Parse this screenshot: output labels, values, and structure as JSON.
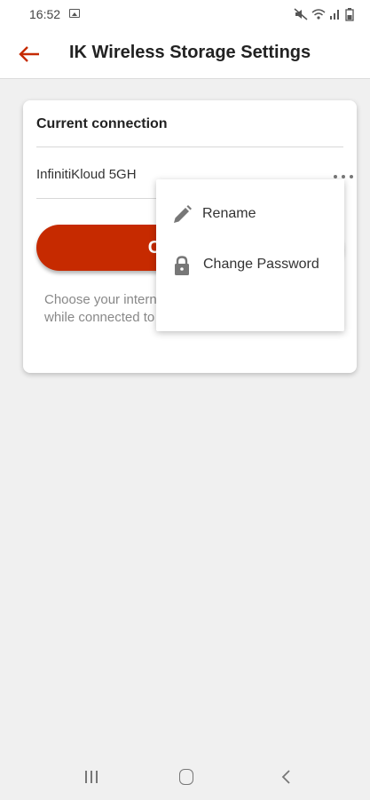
{
  "status_bar": {
    "time": "16:52",
    "icons": [
      "gallery-icon",
      "mute-icon",
      "wifi-icon",
      "signal-icon",
      "battery-icon"
    ]
  },
  "app_bar": {
    "title": "IK Wireless Storage Settings",
    "back_icon": "arrow-left-icon",
    "accent_color": "#c62a00"
  },
  "card": {
    "title": "Current connection",
    "network_name": "InfinitiKloud 5GH",
    "configure_label": "Configure",
    "description": "Choose your internet connection to stay online while connected to IK Wireless Storage."
  },
  "popup_menu": {
    "items": [
      {
        "label": "Rename",
        "icon": "pencil-icon"
      },
      {
        "label": "Change Password",
        "icon": "lock-icon"
      }
    ]
  },
  "nav_bar": {
    "icons": [
      "recents-icon",
      "home-icon",
      "back-icon"
    ]
  }
}
